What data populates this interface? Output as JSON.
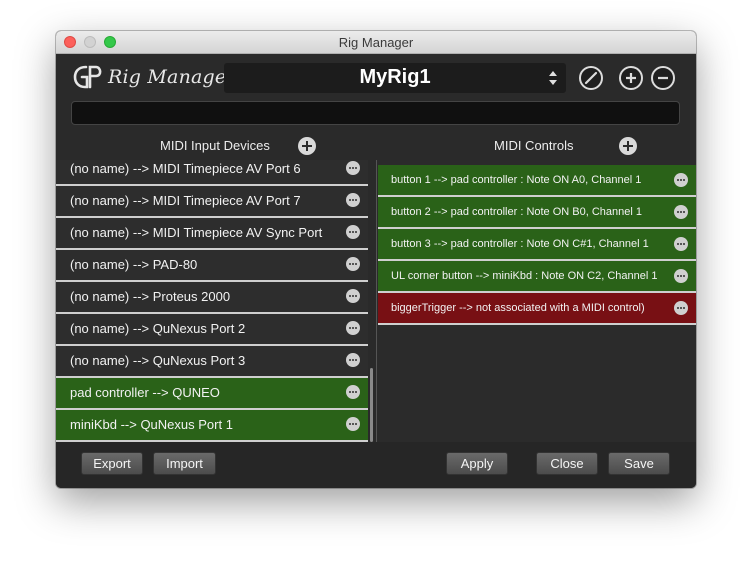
{
  "window": {
    "title": "Rig Manager"
  },
  "header": {
    "logo_text": "Rig Manager",
    "rig_name": "MyRig1"
  },
  "panels": {
    "left_title": "MIDI Input Devices",
    "right_title": "MIDI Controls"
  },
  "devices": [
    {
      "label": "(no name) --> MIDI Timepiece AV Port 6",
      "state": "dark"
    },
    {
      "label": "(no name) --> MIDI Timepiece AV Port 7",
      "state": "dark"
    },
    {
      "label": "(no name) --> MIDI Timepiece AV Sync Port",
      "state": "dark"
    },
    {
      "label": "(no name) --> PAD-80",
      "state": "dark"
    },
    {
      "label": "(no name) --> Proteus 2000",
      "state": "dark"
    },
    {
      "label": "(no name) --> QuNexus Port 2",
      "state": "dark"
    },
    {
      "label": "(no name) --> QuNexus Port 3",
      "state": "dark"
    },
    {
      "label": "pad controller --> QUNEO",
      "state": "green"
    },
    {
      "label": "miniKbd --> QuNexus Port 1",
      "state": "green"
    }
  ],
  "controls": [
    {
      "label": "button 1 --> pad controller : Note ON A0, Channel 1",
      "state": "green"
    },
    {
      "label": "button 2 --> pad controller : Note ON B0, Channel 1",
      "state": "green"
    },
    {
      "label": "button 3 --> pad controller : Note ON C#1, Channel 1",
      "state": "green"
    },
    {
      "label": "UL corner button --> miniKbd : Note ON C2, Channel 1",
      "state": "green"
    },
    {
      "label": "biggerTrigger --> not associated with a MIDI control)",
      "state": "red"
    }
  ],
  "footer": {
    "export_label": "Export",
    "import_label": "Import",
    "apply_label": "Apply",
    "close_label": "Close",
    "save_label": "Save"
  },
  "colors": {
    "assigned_row": "#2a6218",
    "unassigned_row": "#781014",
    "background": "#2a2a2a"
  }
}
